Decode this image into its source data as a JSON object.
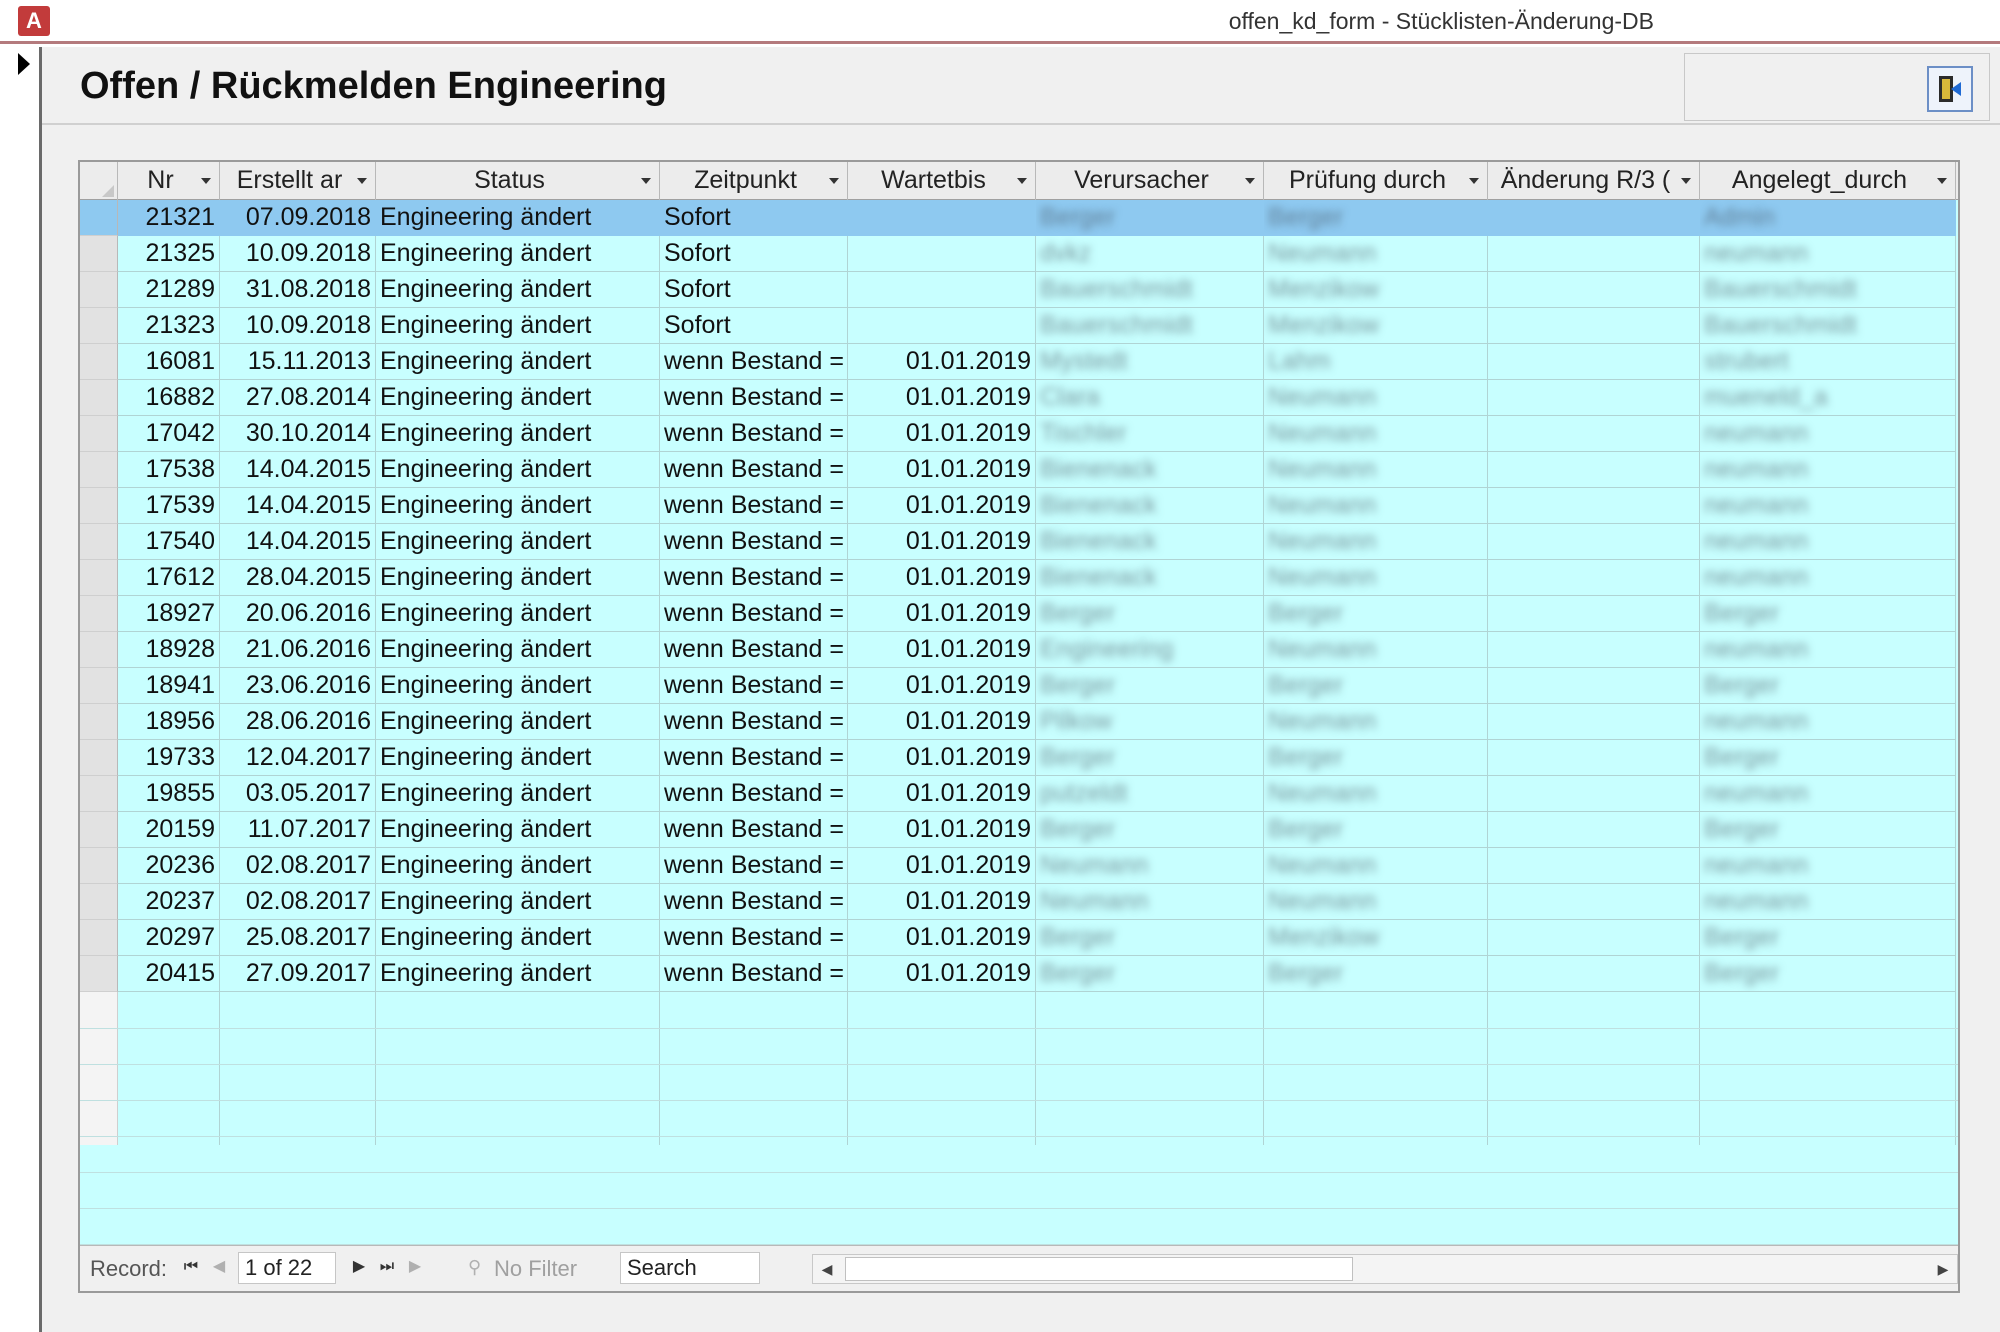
{
  "window": {
    "title": "offen_kd_form - Stücklisten-Änderung-DB",
    "app_icon": "A",
    "accent": "#b47a7d"
  },
  "form": {
    "title": "Offen / Rückmelden Engineering",
    "exit_icon": "exit-door-icon"
  },
  "grid": {
    "columns": [
      "Nr",
      "Erstellt ar",
      "Status",
      "Zeitpunkt",
      "Wartetbis",
      "Verursacher",
      "Prüfung durch",
      "Änderung R/3 (",
      "Angelegt_durch"
    ],
    "rows": [
      {
        "nr": "21321",
        "erstellt": "07.09.2018",
        "status": "Engineering ändert",
        "zeitpunkt": "Sofort",
        "wartetbis": "",
        "verursacher": "Berger",
        "pruefung": "Berger",
        "aenderung": "",
        "angelegt": "Admin"
      },
      {
        "nr": "21325",
        "erstellt": "10.09.2018",
        "status": "Engineering ändert",
        "zeitpunkt": "Sofort",
        "wartetbis": "",
        "verursacher": "dvkz",
        "pruefung": "Neumann",
        "aenderung": "",
        "angelegt": "neumann"
      },
      {
        "nr": "21289",
        "erstellt": "31.08.2018",
        "status": "Engineering ändert",
        "zeitpunkt": "Sofort",
        "wartetbis": "",
        "verursacher": "Bauerschmidt",
        "pruefung": "Menzikow",
        "aenderung": "",
        "angelegt": "Bauerschmidt"
      },
      {
        "nr": "21323",
        "erstellt": "10.09.2018",
        "status": "Engineering ändert",
        "zeitpunkt": "Sofort",
        "wartetbis": "",
        "verursacher": "Bauerschmidt",
        "pruefung": "Menzikow",
        "aenderung": "",
        "angelegt": "Bauerschmidt"
      },
      {
        "nr": "16081",
        "erstellt": "15.11.2013",
        "status": "Engineering ändert",
        "zeitpunkt": "wenn Bestand =",
        "wartetbis": "01.01.2019",
        "verursacher": "Mystedt",
        "pruefung": "Lahm",
        "aenderung": "",
        "angelegt": "strubert"
      },
      {
        "nr": "16882",
        "erstellt": "27.08.2014",
        "status": "Engineering ändert",
        "zeitpunkt": "wenn Bestand =",
        "wartetbis": "01.01.2019",
        "verursacher": "Clara",
        "pruefung": "Neumann",
        "aenderung": "",
        "angelegt": "mueneld_a"
      },
      {
        "nr": "17042",
        "erstellt": "30.10.2014",
        "status": "Engineering ändert",
        "zeitpunkt": "wenn Bestand =",
        "wartetbis": "01.01.2019",
        "verursacher": "Tischler",
        "pruefung": "Neumann",
        "aenderung": "",
        "angelegt": "neumann"
      },
      {
        "nr": "17538",
        "erstellt": "14.04.2015",
        "status": "Engineering ändert",
        "zeitpunkt": "wenn Bestand =",
        "wartetbis": "01.01.2019",
        "verursacher": "Bienenack",
        "pruefung": "Neumann",
        "aenderung": "",
        "angelegt": "neumann"
      },
      {
        "nr": "17539",
        "erstellt": "14.04.2015",
        "status": "Engineering ändert",
        "zeitpunkt": "wenn Bestand =",
        "wartetbis": "01.01.2019",
        "verursacher": "Bienenack",
        "pruefung": "Neumann",
        "aenderung": "",
        "angelegt": "neumann"
      },
      {
        "nr": "17540",
        "erstellt": "14.04.2015",
        "status": "Engineering ändert",
        "zeitpunkt": "wenn Bestand =",
        "wartetbis": "01.01.2019",
        "verursacher": "Bienenack",
        "pruefung": "Neumann",
        "aenderung": "",
        "angelegt": "neumann"
      },
      {
        "nr": "17612",
        "erstellt": "28.04.2015",
        "status": "Engineering ändert",
        "zeitpunkt": "wenn Bestand =",
        "wartetbis": "01.01.2019",
        "verursacher": "Bienenack",
        "pruefung": "Neumann",
        "aenderung": "",
        "angelegt": "neumann"
      },
      {
        "nr": "18927",
        "erstellt": "20.06.2016",
        "status": "Engineering ändert",
        "zeitpunkt": "wenn Bestand =",
        "wartetbis": "01.01.2019",
        "verursacher": "Berger",
        "pruefung": "Berger",
        "aenderung": "",
        "angelegt": "Berger"
      },
      {
        "nr": "18928",
        "erstellt": "21.06.2016",
        "status": "Engineering ändert",
        "zeitpunkt": "wenn Bestand =",
        "wartetbis": "01.01.2019",
        "verursacher": "Engineering",
        "pruefung": "Neumann",
        "aenderung": "",
        "angelegt": "neumann"
      },
      {
        "nr": "18941",
        "erstellt": "23.06.2016",
        "status": "Engineering ändert",
        "zeitpunkt": "wenn Bestand =",
        "wartetbis": "01.01.2019",
        "verursacher": "Berger",
        "pruefung": "Berger",
        "aenderung": "",
        "angelegt": "Berger"
      },
      {
        "nr": "18956",
        "erstellt": "28.06.2016",
        "status": "Engineering ändert",
        "zeitpunkt": "wenn Bestand =",
        "wartetbis": "01.01.2019",
        "verursacher": "Pilkow",
        "pruefung": "Neumann",
        "aenderung": "",
        "angelegt": "neumann"
      },
      {
        "nr": "19733",
        "erstellt": "12.04.2017",
        "status": "Engineering ändert",
        "zeitpunkt": "wenn Bestand =",
        "wartetbis": "01.01.2019",
        "verursacher": "Berger",
        "pruefung": "Berger",
        "aenderung": "",
        "angelegt": "Berger"
      },
      {
        "nr": "19855",
        "erstellt": "03.05.2017",
        "status": "Engineering ändert",
        "zeitpunkt": "wenn Bestand =",
        "wartetbis": "01.01.2019",
        "verursacher": "putzeldt",
        "pruefung": "Neumann",
        "aenderung": "",
        "angelegt": "neumann"
      },
      {
        "nr": "20159",
        "erstellt": "11.07.2017",
        "status": "Engineering ändert",
        "zeitpunkt": "wenn Bestand =",
        "wartetbis": "01.01.2019",
        "verursacher": "Berger",
        "pruefung": "Berger",
        "aenderung": "",
        "angelegt": "Berger"
      },
      {
        "nr": "20236",
        "erstellt": "02.08.2017",
        "status": "Engineering ändert",
        "zeitpunkt": "wenn Bestand =",
        "wartetbis": "01.01.2019",
        "verursacher": "Neumann",
        "pruefung": "Neumann",
        "aenderung": "",
        "angelegt": "neumann"
      },
      {
        "nr": "20237",
        "erstellt": "02.08.2017",
        "status": "Engineering ändert",
        "zeitpunkt": "wenn Bestand =",
        "wartetbis": "01.01.2019",
        "verursacher": "Neumann",
        "pruefung": "Neumann",
        "aenderung": "",
        "angelegt": "neumann"
      },
      {
        "nr": "20297",
        "erstellt": "25.08.2017",
        "status": "Engineering ändert",
        "zeitpunkt": "wenn Bestand =",
        "wartetbis": "01.01.2019",
        "verursacher": "Berger",
        "pruefung": "Menzikow",
        "aenderung": "",
        "angelegt": "Berger"
      },
      {
        "nr": "20415",
        "erstellt": "27.09.2017",
        "status": "Engineering ändert",
        "zeitpunkt": "wenn Bestand =",
        "wartetbis": "01.01.2019",
        "verursacher": "Berger",
        "pruefung": "Berger",
        "aenderung": "",
        "angelegt": "Berger"
      }
    ],
    "selected_row_color": "#8ec9f0",
    "background_color": "#c8ffff"
  },
  "navigator": {
    "record_label": "Record:",
    "record_value": "1 of 22",
    "filter_label": "No Filter",
    "search_placeholder": "Search"
  }
}
